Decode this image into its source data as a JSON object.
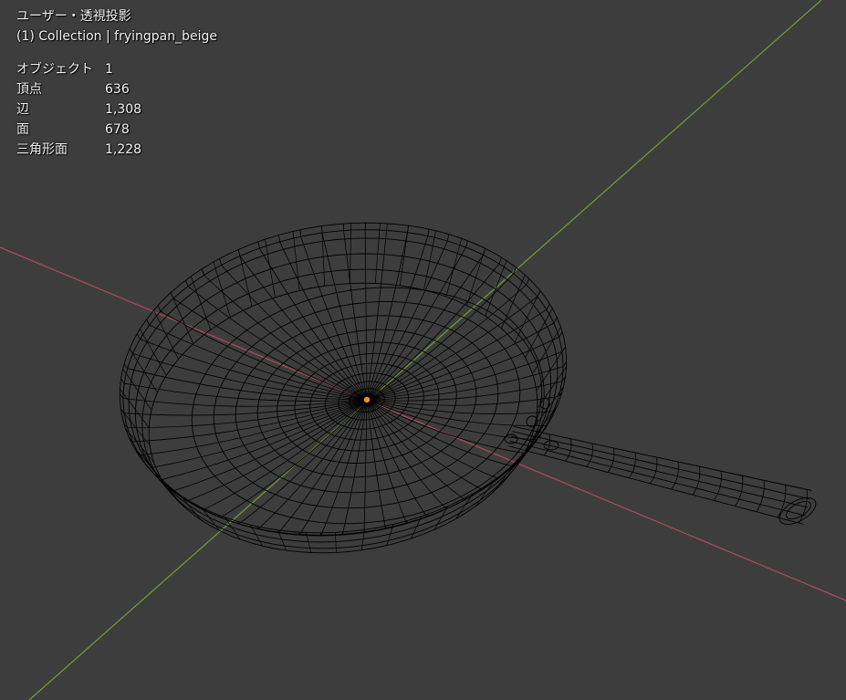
{
  "viewport": {
    "title": "ユーザー・透視投影",
    "collection": "(1) Collection | fryingpan_beige",
    "background_color": "#3d3d3d",
    "x_axis_color": "#a84c58",
    "y_axis_color": "#6f9a35",
    "wire_color": "#000000",
    "origin_color": "#ff8a1f"
  },
  "stats": [
    {
      "label": "オブジェクト",
      "value": "1"
    },
    {
      "label": "頂点",
      "value": "636"
    },
    {
      "label": "辺",
      "value": "1,308"
    },
    {
      "label": "面",
      "value": "678"
    },
    {
      "label": "三角形面",
      "value": "1,228"
    }
  ],
  "object": {
    "name": "fryingpan_beige",
    "display_mode": "wireframe"
  }
}
